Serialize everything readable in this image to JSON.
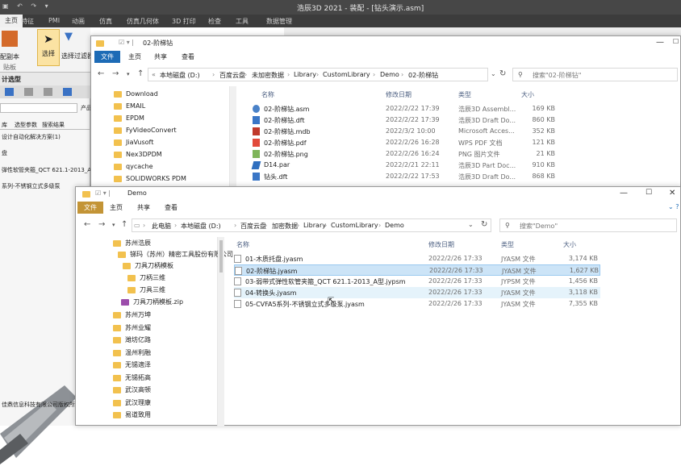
{
  "cad": {
    "title": "浩辰3D 2021 - 装配 - [钻头演示.asm]",
    "menu": [
      "特征",
      "PMI",
      "动画",
      "仿真",
      "仿真几何体",
      "3D 打印",
      "检查",
      "工具",
      "数据管理"
    ],
    "active_menu": "主页",
    "ribbon": {
      "paste_label": "配副本",
      "select_label": "选择",
      "filter_label": "选择过滤器",
      "pane_label": "贴板"
    },
    "left": {
      "header": "计选型",
      "label": "产品",
      "tabs": [
        "库",
        "选型参数",
        "搜索结果"
      ],
      "lines": [
        "设计自动化解决方案(1)",
        "盘",
        "弹性软管夹箍_QCT 621.1-2013_A型",
        "系列-不锈钢立式多级泵"
      ],
      "footer": "佳鼎信息科技有限公司版权所有"
    }
  },
  "win1": {
    "title": "02-阶梯钻",
    "tabs": {
      "file": "文件",
      "home": "主页",
      "share": "共享",
      "view": "查看"
    },
    "crumbs": [
      "本地磁盘 (D:)",
      "百度云盘",
      "未加密数据",
      "Library",
      "CustomLibrary",
      "Demo",
      "02-阶梯钻"
    ],
    "search_placeholder": "搜索\"02-阶梯钻\"",
    "columns": {
      "name": "名称",
      "date": "修改日期",
      "type": "类型",
      "size": "大小"
    },
    "nav": [
      "Download",
      "EMAIL",
      "EPDM",
      "FyVideoConvert",
      "JiaVusoft",
      "Nex3DPDM",
      "qycache",
      "SOLIDWORKS PDM"
    ],
    "files": [
      {
        "name": "02-阶梯钻.asm",
        "date": "2022/2/22 17:39",
        "type": "浩辰3D Assembl...",
        "size": "169 KB",
        "icon": "asm-icon"
      },
      {
        "name": "02-阶梯钻.dft",
        "date": "2022/2/22 17:39",
        "type": "浩辰3D Draft Do...",
        "size": "860 KB",
        "icon": "dft-icon"
      },
      {
        "name": "02-阶梯钻.mdb",
        "date": "2022/3/2 10:00",
        "type": "Microsoft Acces...",
        "size": "352 KB",
        "icon": "mdb-icon"
      },
      {
        "name": "02-阶梯钻.pdf",
        "date": "2022/2/26 16:28",
        "type": "WPS PDF 文档",
        "size": "121 KB",
        "icon": "pdf-icon"
      },
      {
        "name": "02-阶梯钻.png",
        "date": "2022/2/26 16:24",
        "type": "PNG 图片文件",
        "size": "21 KB",
        "icon": "png-icon"
      },
      {
        "name": "D14.par",
        "date": "2022/2/21 22:11",
        "type": "浩辰3D Part Doc...",
        "size": "910 KB",
        "icon": "par-icon"
      },
      {
        "name": "钻头.dft",
        "date": "2022/2/22 17:53",
        "type": "浩辰3D Draft Do...",
        "size": "868 KB",
        "icon": "dft-icon"
      }
    ]
  },
  "win2": {
    "title": "Demo",
    "tabs": {
      "file": "文件",
      "home": "主页",
      "share": "共享",
      "view": "查看"
    },
    "crumbs": [
      "此电脑",
      "本地磁盘 (D:)",
      "百度云盘",
      "加密数据",
      "Library",
      "CustomLibrary",
      "Demo"
    ],
    "search_placeholder": "搜索\"Demo\"",
    "columns": {
      "name": "名称",
      "date": "修改日期",
      "type": "类型",
      "size": "大小"
    },
    "nav": [
      "苏州浩辰",
      "锑玛（苏州）精密工具股份有限公司",
      "刀具刀柄模板",
      "刀柄三维",
      "刀具三维",
      "刀具刀柄模板.zip",
      "苏州万坤",
      "苏州业耀",
      "潍坊亿路",
      "温州利融",
      "无锡適泽",
      "无锡拓高",
      "武汉高顿",
      "武汉理康",
      "易道致用"
    ],
    "files": [
      {
        "name": "01-木质托盘.jyasm",
        "date": "2022/2/26 17:33",
        "type": "JYASM 文件",
        "size": "3,174 KB"
      },
      {
        "name": "02-阶梯钻.jyasm",
        "date": "2022/2/26 17:33",
        "type": "JYASM 文件",
        "size": "1,627 KB"
      },
      {
        "name": "03-弱带式弹性软管夹箍_QCT 621.1-2013_A型.jypsm",
        "date": "2022/2/26 17:33",
        "type": "JYPSM 文件",
        "size": "1,456 KB"
      },
      {
        "name": "04-转换头.jyasm",
        "date": "2022/2/26 17:33",
        "type": "JYASM 文件",
        "size": "3,118 KB"
      },
      {
        "name": "05-CVFA5系列-不锈钢立式多级泵.jyasm",
        "date": "2022/2/26 17:33",
        "type": "JYASM 文件",
        "size": "7,355 KB"
      }
    ]
  }
}
